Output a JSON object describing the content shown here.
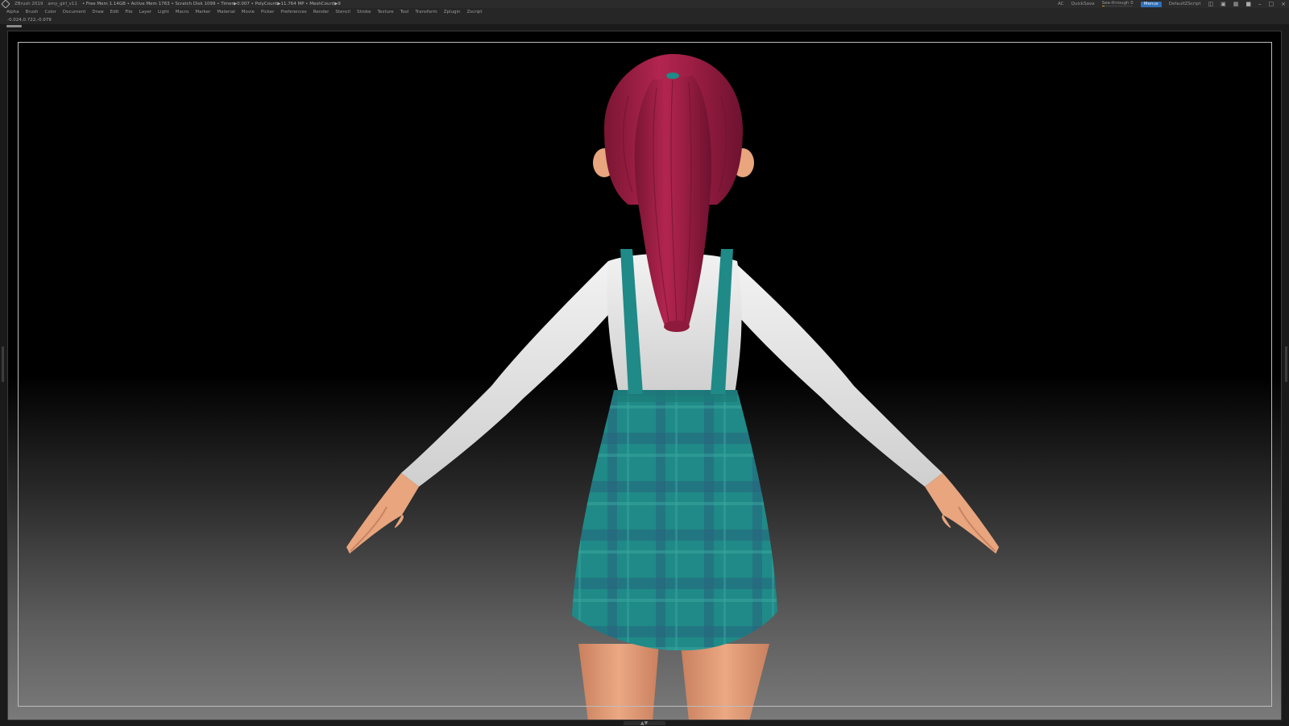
{
  "titlebar": {
    "app_name": "ZBrush 2019",
    "document_name": "amy_girl_v11",
    "stats": "• Free Mem 1.14GB • Active Mem 1763 • Scratch Disk 1099 • Timer▶0.007 • PolyCount▶11.764 MP • MeshCount▶9",
    "ac_label": "AC",
    "quicksave_label": "QuickSave",
    "see_through_label": "See-through",
    "see_through_value": "0",
    "see_through_level": 0.1,
    "menus_button_label": "Menus",
    "script_label": "DefaultZScript"
  },
  "menubar": {
    "items": [
      "Alpha",
      "Brush",
      "Color",
      "Document",
      "Draw",
      "Edit",
      "File",
      "Layer",
      "Light",
      "Macro",
      "Marker",
      "Material",
      "Movie",
      "Picker",
      "Preferences",
      "Render",
      "Stencil",
      "Stroke",
      "Texture",
      "Tool",
      "Transform",
      "Zplugin",
      "Zscript"
    ]
  },
  "coords": "-0.024,0.722,-0.079",
  "colors": {
    "ui_background": "#262626",
    "titlebar_background": "#2b2b2b",
    "menus_button": "#2f6fb8",
    "see_through_fill": "#d8a000",
    "hair": "#a01f45",
    "skin": "#e8a57e",
    "shirt": "#e6e6e6",
    "skirt": "#1f8a87"
  },
  "icons": [
    "zbrush-logo-icon",
    "window-layout-icon",
    "palette-icon",
    "dock-icon",
    "lock-icon",
    "minimize-icon",
    "maximize-icon",
    "close-icon"
  ]
}
